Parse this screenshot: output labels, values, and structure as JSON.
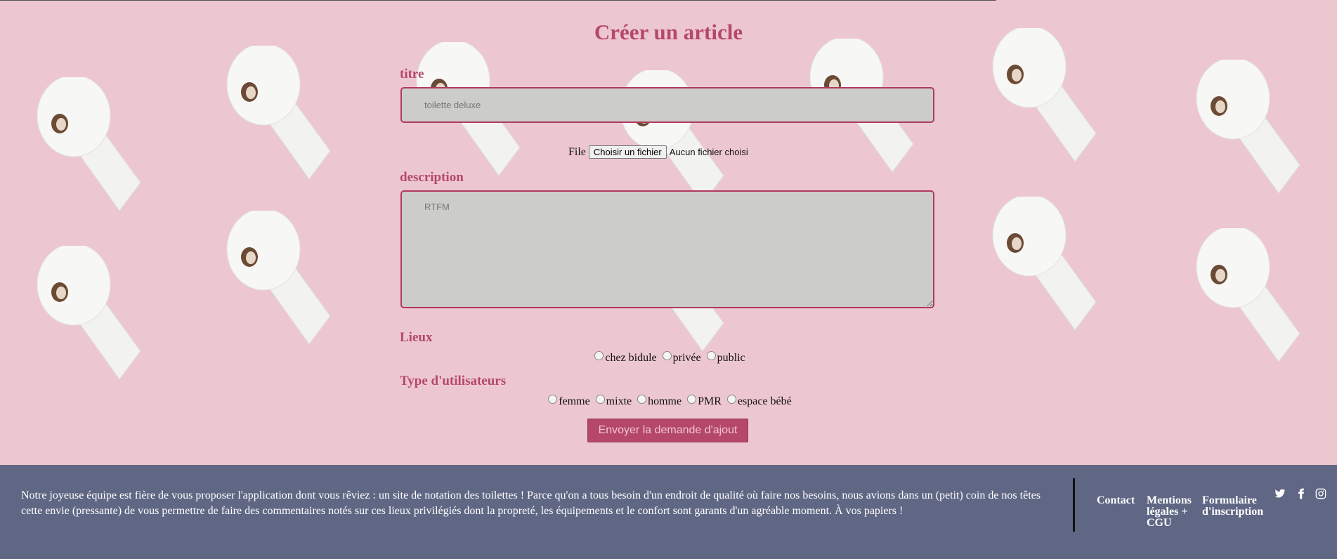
{
  "page": {
    "title": "Créer un article"
  },
  "form": {
    "title_label": "titre",
    "title_value": "toilette deluxe",
    "file_label": "File",
    "file_button": "Choisir un fichier",
    "file_status": "Aucun fichier choisi",
    "description_label": "description",
    "description_value": "RTFM",
    "lieux_label": "Lieux",
    "lieux_options": [
      "chez bidule",
      "privée",
      "public"
    ],
    "users_label": "Type d'utilisateurs",
    "users_options": [
      "femme",
      "mixte",
      "homme",
      "PMR",
      "espace bébé"
    ],
    "submit_label": "Envoyer la demande d'ajout"
  },
  "footer": {
    "text": "Notre joyeuse équipe est fière de vous proposer l'application dont vous rêviez : un site de notation des toilettes ! Parce qu'on a tous besoin d'un endroit de qualité où faire nos besoins, nous avions dans un (petit) coin de nos têtes cette envie (pressante) de vous permettre de faire des commentaires notés sur ces lieux privilégiés dont la propreté, les équipements et le confort sont garants d'un agréable moment. À vos papiers !",
    "links": [
      "Contact",
      "Mentions légales + CGU",
      "Formulaire d'inscription"
    ],
    "social_icons": [
      "twitter-icon",
      "facebook-icon",
      "instagram-icon"
    ]
  },
  "colors": {
    "accent": "#b5486a",
    "background": "#edc7d0",
    "footer": "#54607e",
    "field": "#ccccc8"
  }
}
